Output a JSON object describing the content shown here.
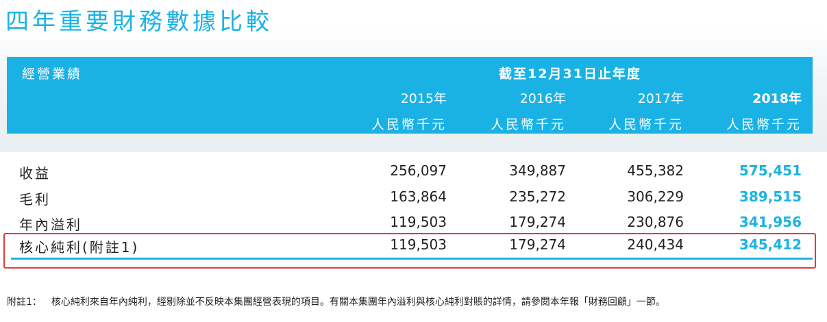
{
  "title": "四年重要財務數據比較",
  "header": {
    "section_label": "經營業績",
    "period_label": "截至12月31日止年度",
    "years": [
      "2015年",
      "2016年",
      "2017年",
      "2018年"
    ],
    "unit": "人民幣千元"
  },
  "rows": [
    {
      "label": "收益",
      "values": [
        "256,097",
        "349,887",
        "455,382",
        "575,451"
      ]
    },
    {
      "label": "毛利",
      "values": [
        "163,864",
        "235,272",
        "306,229",
        "389,515"
      ]
    },
    {
      "label": "年內溢利",
      "values": [
        "119,503",
        "179,274",
        "230,876",
        "341,956"
      ]
    },
    {
      "label": "核心純利(附註1)",
      "values": [
        "119,503",
        "179,274",
        "240,434",
        "345,412"
      ]
    }
  ],
  "footnote": {
    "mark": "附註1：",
    "text": "核心純利來自年內純利，經剔除並不反映本集團經營表現的項目。有關本集團年內溢利與核心純利對賬的詳情，請參閱本年報「財務回顧」一節。"
  },
  "colors": {
    "accent": "#1ab2e5",
    "highlight": "#e23b36"
  }
}
